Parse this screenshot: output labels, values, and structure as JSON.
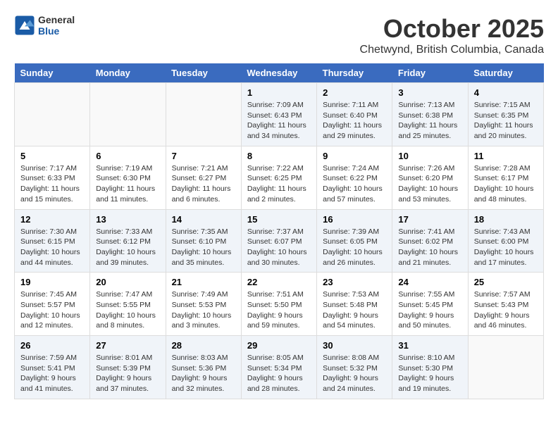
{
  "header": {
    "logo_general": "General",
    "logo_blue": "Blue",
    "month": "October 2025",
    "location": "Chetwynd, British Columbia, Canada"
  },
  "weekdays": [
    "Sunday",
    "Monday",
    "Tuesday",
    "Wednesday",
    "Thursday",
    "Friday",
    "Saturday"
  ],
  "weeks": [
    [
      {
        "day": "",
        "sunrise": "",
        "sunset": "",
        "daylight": ""
      },
      {
        "day": "",
        "sunrise": "",
        "sunset": "",
        "daylight": ""
      },
      {
        "day": "",
        "sunrise": "",
        "sunset": "",
        "daylight": ""
      },
      {
        "day": "1",
        "sunrise": "Sunrise: 7:09 AM",
        "sunset": "Sunset: 6:43 PM",
        "daylight": "Daylight: 11 hours and 34 minutes."
      },
      {
        "day": "2",
        "sunrise": "Sunrise: 7:11 AM",
        "sunset": "Sunset: 6:40 PM",
        "daylight": "Daylight: 11 hours and 29 minutes."
      },
      {
        "day": "3",
        "sunrise": "Sunrise: 7:13 AM",
        "sunset": "Sunset: 6:38 PM",
        "daylight": "Daylight: 11 hours and 25 minutes."
      },
      {
        "day": "4",
        "sunrise": "Sunrise: 7:15 AM",
        "sunset": "Sunset: 6:35 PM",
        "daylight": "Daylight: 11 hours and 20 minutes."
      }
    ],
    [
      {
        "day": "5",
        "sunrise": "Sunrise: 7:17 AM",
        "sunset": "Sunset: 6:33 PM",
        "daylight": "Daylight: 11 hours and 15 minutes."
      },
      {
        "day": "6",
        "sunrise": "Sunrise: 7:19 AM",
        "sunset": "Sunset: 6:30 PM",
        "daylight": "Daylight: 11 hours and 11 minutes."
      },
      {
        "day": "7",
        "sunrise": "Sunrise: 7:21 AM",
        "sunset": "Sunset: 6:27 PM",
        "daylight": "Daylight: 11 hours and 6 minutes."
      },
      {
        "day": "8",
        "sunrise": "Sunrise: 7:22 AM",
        "sunset": "Sunset: 6:25 PM",
        "daylight": "Daylight: 11 hours and 2 minutes."
      },
      {
        "day": "9",
        "sunrise": "Sunrise: 7:24 AM",
        "sunset": "Sunset: 6:22 PM",
        "daylight": "Daylight: 10 hours and 57 minutes."
      },
      {
        "day": "10",
        "sunrise": "Sunrise: 7:26 AM",
        "sunset": "Sunset: 6:20 PM",
        "daylight": "Daylight: 10 hours and 53 minutes."
      },
      {
        "day": "11",
        "sunrise": "Sunrise: 7:28 AM",
        "sunset": "Sunset: 6:17 PM",
        "daylight": "Daylight: 10 hours and 48 minutes."
      }
    ],
    [
      {
        "day": "12",
        "sunrise": "Sunrise: 7:30 AM",
        "sunset": "Sunset: 6:15 PM",
        "daylight": "Daylight: 10 hours and 44 minutes."
      },
      {
        "day": "13",
        "sunrise": "Sunrise: 7:33 AM",
        "sunset": "Sunset: 6:12 PM",
        "daylight": "Daylight: 10 hours and 39 minutes."
      },
      {
        "day": "14",
        "sunrise": "Sunrise: 7:35 AM",
        "sunset": "Sunset: 6:10 PM",
        "daylight": "Daylight: 10 hours and 35 minutes."
      },
      {
        "day": "15",
        "sunrise": "Sunrise: 7:37 AM",
        "sunset": "Sunset: 6:07 PM",
        "daylight": "Daylight: 10 hours and 30 minutes."
      },
      {
        "day": "16",
        "sunrise": "Sunrise: 7:39 AM",
        "sunset": "Sunset: 6:05 PM",
        "daylight": "Daylight: 10 hours and 26 minutes."
      },
      {
        "day": "17",
        "sunrise": "Sunrise: 7:41 AM",
        "sunset": "Sunset: 6:02 PM",
        "daylight": "Daylight: 10 hours and 21 minutes."
      },
      {
        "day": "18",
        "sunrise": "Sunrise: 7:43 AM",
        "sunset": "Sunset: 6:00 PM",
        "daylight": "Daylight: 10 hours and 17 minutes."
      }
    ],
    [
      {
        "day": "19",
        "sunrise": "Sunrise: 7:45 AM",
        "sunset": "Sunset: 5:57 PM",
        "daylight": "Daylight: 10 hours and 12 minutes."
      },
      {
        "day": "20",
        "sunrise": "Sunrise: 7:47 AM",
        "sunset": "Sunset: 5:55 PM",
        "daylight": "Daylight: 10 hours and 8 minutes."
      },
      {
        "day": "21",
        "sunrise": "Sunrise: 7:49 AM",
        "sunset": "Sunset: 5:53 PM",
        "daylight": "Daylight: 10 hours and 3 minutes."
      },
      {
        "day": "22",
        "sunrise": "Sunrise: 7:51 AM",
        "sunset": "Sunset: 5:50 PM",
        "daylight": "Daylight: 9 hours and 59 minutes."
      },
      {
        "day": "23",
        "sunrise": "Sunrise: 7:53 AM",
        "sunset": "Sunset: 5:48 PM",
        "daylight": "Daylight: 9 hours and 54 minutes."
      },
      {
        "day": "24",
        "sunrise": "Sunrise: 7:55 AM",
        "sunset": "Sunset: 5:45 PM",
        "daylight": "Daylight: 9 hours and 50 minutes."
      },
      {
        "day": "25",
        "sunrise": "Sunrise: 7:57 AM",
        "sunset": "Sunset: 5:43 PM",
        "daylight": "Daylight: 9 hours and 46 minutes."
      }
    ],
    [
      {
        "day": "26",
        "sunrise": "Sunrise: 7:59 AM",
        "sunset": "Sunset: 5:41 PM",
        "daylight": "Daylight: 9 hours and 41 minutes."
      },
      {
        "day": "27",
        "sunrise": "Sunrise: 8:01 AM",
        "sunset": "Sunset: 5:39 PM",
        "daylight": "Daylight: 9 hours and 37 minutes."
      },
      {
        "day": "28",
        "sunrise": "Sunrise: 8:03 AM",
        "sunset": "Sunset: 5:36 PM",
        "daylight": "Daylight: 9 hours and 32 minutes."
      },
      {
        "day": "29",
        "sunrise": "Sunrise: 8:05 AM",
        "sunset": "Sunset: 5:34 PM",
        "daylight": "Daylight: 9 hours and 28 minutes."
      },
      {
        "day": "30",
        "sunrise": "Sunrise: 8:08 AM",
        "sunset": "Sunset: 5:32 PM",
        "daylight": "Daylight: 9 hours and 24 minutes."
      },
      {
        "day": "31",
        "sunrise": "Sunrise: 8:10 AM",
        "sunset": "Sunset: 5:30 PM",
        "daylight": "Daylight: 9 hours and 19 minutes."
      },
      {
        "day": "",
        "sunrise": "",
        "sunset": "",
        "daylight": ""
      }
    ]
  ]
}
